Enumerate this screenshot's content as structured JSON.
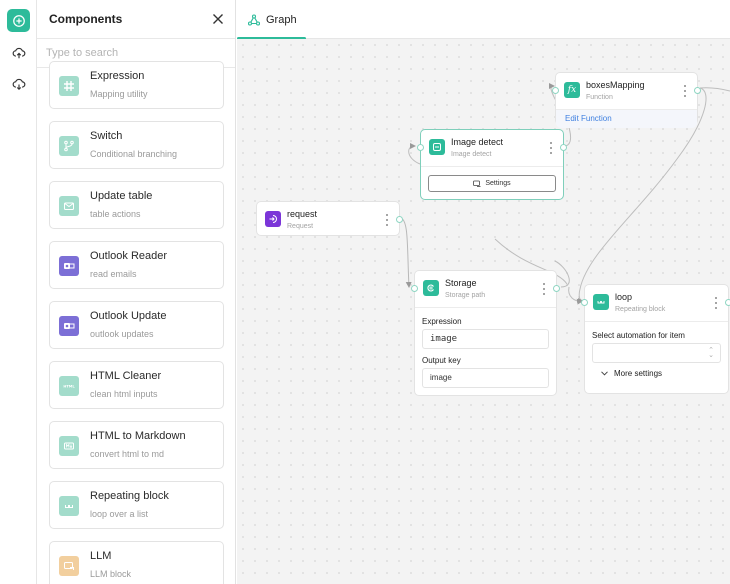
{
  "rail": {
    "items": [
      {
        "icon": "add-circle-icon",
        "active": true
      },
      {
        "icon": "cloud-upload-icon",
        "active": false
      },
      {
        "icon": "cloud-download-icon",
        "active": false
      }
    ]
  },
  "panel": {
    "title": "Components",
    "search_placeholder": "Type to search",
    "search_value": "",
    "components": [
      {
        "name": "Expression",
        "desc": "Mapping utility",
        "icon": "hash-icon",
        "color": "#a3dccb"
      },
      {
        "name": "Switch",
        "desc": "Conditional branching",
        "icon": "branch-icon",
        "color": "#a3dccb"
      },
      {
        "name": "Update table",
        "desc": "table actions",
        "icon": "mail-edit-icon",
        "color": "#a3dccb"
      },
      {
        "name": "Outlook Reader",
        "desc": "read emails",
        "icon": "outlook-icon",
        "color": "#7c6fd6"
      },
      {
        "name": "Outlook Update",
        "desc": "outlook updates",
        "icon": "outlook-icon",
        "color": "#7c6fd6"
      },
      {
        "name": "HTML Cleaner",
        "desc": "clean html inputs",
        "icon": "html-icon",
        "color": "#a3dccb"
      },
      {
        "name": "HTML to Markdown",
        "desc": "convert html to md",
        "icon": "markdown-icon",
        "color": "#a3dccb"
      },
      {
        "name": "Repeating block",
        "desc": "loop over a list",
        "icon": "loop-icon",
        "color": "#a3dccb"
      },
      {
        "name": "LLM",
        "desc": "LLM block",
        "icon": "llm-icon",
        "color": "#f2cf9e"
      }
    ]
  },
  "tabs": [
    {
      "label": "Graph",
      "icon": "graph-icon",
      "active": true
    }
  ],
  "accent": "#2dbb9a",
  "nodes": {
    "boxes_mapping": {
      "title": "boxesMapping",
      "subtitle": "Function",
      "action": "Edit Function",
      "icon": "function-icon",
      "color": "#2dbb9a"
    },
    "image_detect": {
      "title": "Image detect",
      "subtitle": "Image detect",
      "button": "Settings",
      "icon": "image-detect-icon",
      "color": "#2dbb9a"
    },
    "request": {
      "title": "request",
      "subtitle": "Request",
      "icon": "login-icon",
      "color": "#7b35d8"
    },
    "storage": {
      "title": "Storage",
      "subtitle": "Storage path",
      "icon": "storage-icon",
      "color": "#2dbb9a",
      "fields": [
        {
          "label": "Expression",
          "value": "image"
        },
        {
          "label": "Output key",
          "value": "image"
        }
      ]
    },
    "loop": {
      "title": "loop",
      "subtitle": "Repeating block",
      "icon": "loop-icon",
      "color": "#2dbb9a",
      "select_label": "Select automation for item",
      "select_value": "",
      "more_settings": "More settings"
    }
  }
}
